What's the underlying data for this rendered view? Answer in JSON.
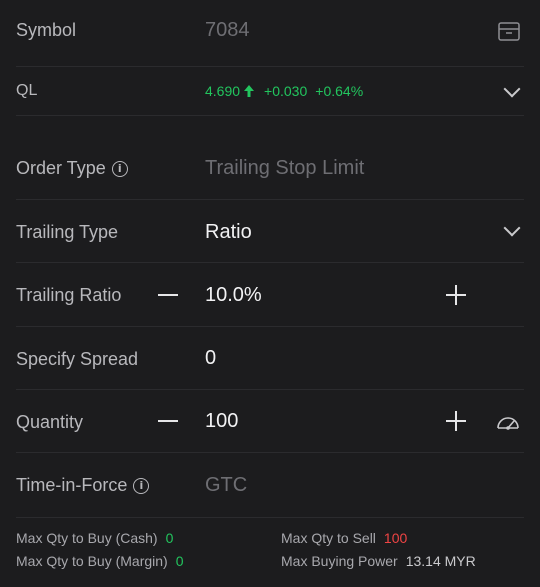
{
  "symbol": {
    "label": "Symbol",
    "value": "7084"
  },
  "ql": {
    "label": "QL",
    "price": "4.690",
    "change": "+0.030",
    "change_pct": "+0.64%"
  },
  "order_type": {
    "label": "Order Type",
    "value": "Trailing Stop Limit"
  },
  "trailing_type": {
    "label": "Trailing Type",
    "value": "Ratio"
  },
  "trailing_ratio": {
    "label": "Trailing Ratio",
    "value": "10.0%"
  },
  "specify_spread": {
    "label": "Specify Spread",
    "value": "0"
  },
  "quantity": {
    "label": "Quantity",
    "value": "100"
  },
  "time_in_force": {
    "label": "Time-in-Force",
    "value": "GTC"
  },
  "footer": {
    "max_qty_buy_cash_label": "Max Qty to Buy (Cash)",
    "max_qty_buy_cash_value": "0",
    "max_qty_buy_margin_label": "Max Qty to Buy (Margin)",
    "max_qty_buy_margin_value": "0",
    "max_qty_sell_label": "Max Qty to Sell",
    "max_qty_sell_value": "100",
    "max_buying_power_label": "Max Buying Power",
    "max_buying_power_value": "13.14 MYR"
  },
  "colors": {
    "up": "#22c55e",
    "down": "#ef4444",
    "background": "#1c1c1e"
  },
  "icons": [
    "calendar-icon",
    "up-arrow-icon",
    "chevron-down-icon",
    "info-icon",
    "minus-icon",
    "plus-icon",
    "gauge-icon"
  ]
}
